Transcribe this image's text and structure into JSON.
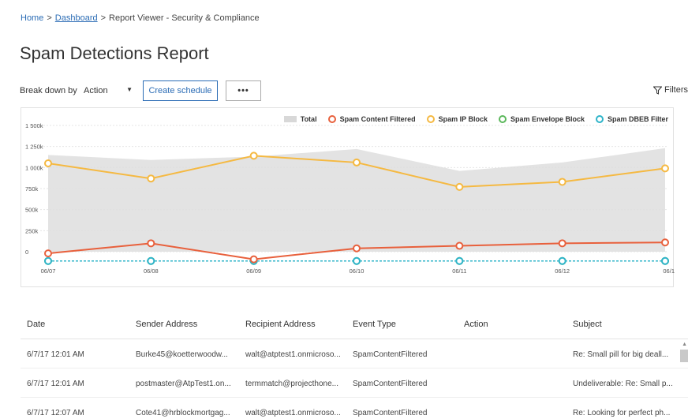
{
  "breadcrumb": {
    "home": "Home",
    "sep1": ">",
    "dashboard": "Dashboard",
    "sep2": ">",
    "current": "Report Viewer - Security & Compliance"
  },
  "page_title": "Spam Detections Report",
  "toolbar": {
    "breakdown_label": "Break down by",
    "breakdown_value": "Action",
    "create_schedule": "Create schedule",
    "more": "•••",
    "filters": "Filters"
  },
  "chart_data": {
    "type": "line",
    "x": [
      "06/07",
      "06/08",
      "06/09",
      "06/10",
      "06/11",
      "06/12",
      "06/1"
    ],
    "yticks": [
      "1 500k",
      "1 250k",
      "1 000k",
      "750k",
      "500k",
      "250k",
      "0"
    ],
    "ylim": [
      0,
      1500000
    ],
    "grid": true,
    "legend_position": "top-right",
    "series": [
      {
        "name": "Total",
        "kind": "area",
        "color": "#d9d9d9",
        "values": [
          1150000,
          1090000,
          1130000,
          1220000,
          960000,
          1060000,
          1230000
        ]
      },
      {
        "name": "Spam Content Filtered",
        "color": "#e8603c",
        "values": [
          -20000,
          100000,
          -90000,
          40000,
          70000,
          100000,
          110000
        ]
      },
      {
        "name": "Spam IP Block",
        "color": "#f5b942",
        "values": [
          1050000,
          870000,
          1140000,
          1060000,
          770000,
          830000,
          990000
        ]
      },
      {
        "name": "Spam Envelope Block",
        "color": "#5cb85c",
        "values": [
          -110000,
          -110000,
          -110000,
          -110000,
          -110000,
          -110000,
          -110000
        ]
      },
      {
        "name": "Spam DBEB Filter",
        "color": "#2fb4c9",
        "values": [
          -110000,
          -110000,
          -110000,
          -110000,
          -110000,
          -110000,
          -110000
        ]
      }
    ]
  },
  "table": {
    "columns": [
      "Date",
      "Sender Address",
      "Recipient Address",
      "Event Type",
      "Action",
      "Subject"
    ],
    "rows": [
      [
        "6/7/17 12:01 AM",
        "Burke45@koetterwoodw...",
        "walt@atptest1.onmicroso...",
        "SpamContentFiltered",
        "",
        "Re: Small pill for big deall..."
      ],
      [
        "6/7/17 12:01 AM",
        "postmaster@AtpTest1.on...",
        "termmatch@projecthone...",
        "SpamContentFiltered",
        "",
        "Undeliverable: Re: Small p..."
      ],
      [
        "6/7/17 12:07 AM",
        "Cote41@hrblockmortgag...",
        "walt@atptest1.onmicroso...",
        "SpamContentFiltered",
        "",
        "Re: Looking for perfect ph..."
      ]
    ]
  },
  "icons": {
    "dropdown": "chevron-down-icon",
    "filter": "filter-icon",
    "more": "more-icon",
    "scroll_up": "scroll-up-icon"
  }
}
